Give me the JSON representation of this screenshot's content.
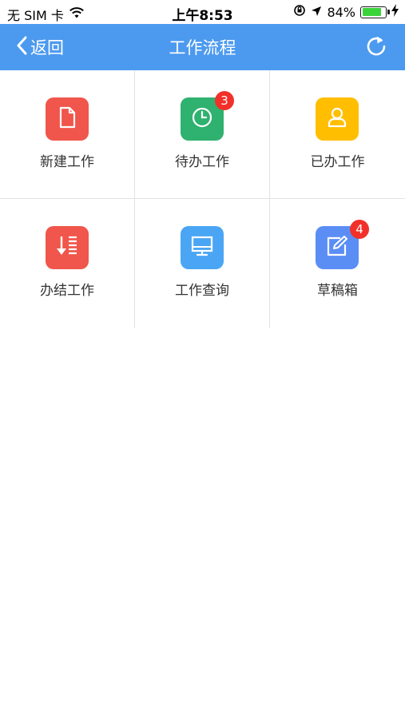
{
  "status_bar": {
    "carrier": "无 SIM 卡",
    "time": "上午8:53",
    "battery_percent": "84%",
    "battery_level": 0.84
  },
  "nav": {
    "back_label": "返回",
    "title": "工作流程"
  },
  "grid": {
    "items": [
      {
        "label": "新建工作",
        "color": "#f0564b",
        "icon": "document-icon"
      },
      {
        "label": "待办工作",
        "color": "#2fb16f",
        "icon": "clock-icon",
        "badge": "3"
      },
      {
        "label": "已办工作",
        "color": "#ffbe00",
        "icon": "person-icon"
      },
      {
        "label": "办结工作",
        "color": "#f0564b",
        "icon": "download-list-icon"
      },
      {
        "label": "工作查询",
        "color": "#4aa6f5",
        "icon": "monitor-icon"
      },
      {
        "label": "草稿箱",
        "color": "#5b8ef5",
        "icon": "edit-icon",
        "badge": "4"
      }
    ]
  },
  "colors": {
    "nav_background": "#4c9aef",
    "badge": "#f2302a",
    "battery_fill": "#3ad43a"
  }
}
